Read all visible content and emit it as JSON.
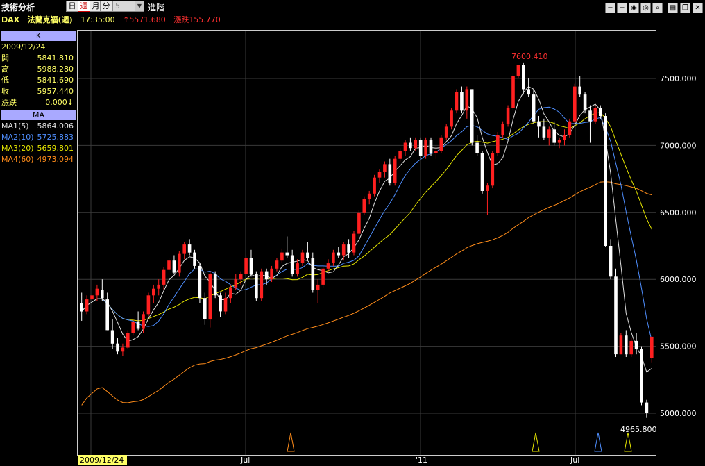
{
  "app": {
    "title": "技術分析"
  },
  "toolbar": {
    "periods": [
      "日",
      "週",
      "月",
      "分"
    ],
    "active_period": "週",
    "minute_value": "5",
    "advanced_label": "進階"
  },
  "info": {
    "symbol": "DAX",
    "name": "法蘭克福(週)",
    "time": "17:35:00",
    "last_arrow": "↑",
    "last": "5571.680",
    "change_label": "漲跌",
    "change": "155.770"
  },
  "panel": {
    "k_header": "K",
    "date": "2009/12/24",
    "ohlc": [
      {
        "label": "開",
        "value": "5841.810"
      },
      {
        "label": "高",
        "value": "5988.280"
      },
      {
        "label": "低",
        "value": "5841.690"
      },
      {
        "label": "收",
        "value": "5957.440"
      },
      {
        "label": "漲跌",
        "value": "0.000↓"
      }
    ],
    "ma_header": "MA",
    "ma": [
      {
        "label": "MA1(5)",
        "value": "5864.006",
        "color": "#e0e0e0"
      },
      {
        "label": "MA2(10)",
        "value": "5725.883",
        "color": "#4f8fff"
      },
      {
        "label": "MA3(20)",
        "value": "5659.801",
        "color": "#e6e600"
      },
      {
        "label": "MA4(60)",
        "value": "4973.094",
        "color": "#ff8c1a"
      }
    ]
  },
  "chart_data": {
    "type": "candlestick",
    "y_ticks": [
      "7500.000",
      "7000.000",
      "6500.000",
      "6000.000",
      "5500.000",
      "5000.000"
    ],
    "x_ticks": [
      "2009/12/24",
      "Jul",
      "'11",
      "Jul"
    ],
    "ylim": [
      4800,
      7800
    ],
    "max_label": "7600.410",
    "min_label": "4965.800",
    "colors": {
      "up": "#ff2020",
      "down": "#ffffff",
      "ma5": "#e0e0e0",
      "ma10": "#4f8fff",
      "ma20": "#e6e600",
      "ma60": "#ff8c1a"
    },
    "candles": [
      [
        5820,
        5900,
        5690,
        5760
      ],
      [
        5760,
        5880,
        5740,
        5850
      ],
      [
        5850,
        5900,
        5800,
        5880
      ],
      [
        5880,
        5960,
        5840,
        5930
      ],
      [
        5920,
        6000,
        5840,
        5860
      ],
      [
        5850,
        5900,
        5620,
        5620
      ],
      [
        5620,
        5700,
        5480,
        5520
      ],
      [
        5520,
        5560,
        5440,
        5460
      ],
      [
        5460,
        5520,
        5430,
        5490
      ],
      [
        5490,
        5620,
        5480,
        5600
      ],
      [
        5600,
        5700,
        5580,
        5680
      ],
      [
        5680,
        5760,
        5620,
        5630
      ],
      [
        5630,
        5760,
        5600,
        5740
      ],
      [
        5740,
        5900,
        5720,
        5880
      ],
      [
        5880,
        5960,
        5820,
        5930
      ],
      [
        5930,
        6000,
        5880,
        5960
      ],
      [
        5960,
        6090,
        5920,
        6070
      ],
      [
        6070,
        6160,
        6050,
        6140
      ],
      [
        6140,
        6180,
        6040,
        6050
      ],
      [
        6050,
        6210,
        6020,
        6190
      ],
      [
        6190,
        6280,
        6150,
        6260
      ],
      [
        6260,
        6300,
        6180,
        6200
      ],
      [
        6200,
        6220,
        6080,
        6100
      ],
      [
        6100,
        6120,
        5820,
        5860
      ],
      [
        5860,
        5900,
        5660,
        5700
      ],
      [
        5700,
        6060,
        5640,
        6040
      ],
      [
        6040,
        6060,
        5860,
        5880
      ],
      [
        5880,
        5900,
        5720,
        5760
      ],
      [
        5760,
        5900,
        5740,
        5860
      ],
      [
        5860,
        5960,
        5820,
        5940
      ],
      [
        5940,
        6040,
        5920,
        6000
      ],
      [
        6000,
        6060,
        5960,
        6040
      ],
      [
        6040,
        6180,
        6020,
        6160
      ],
      [
        6160,
        6220,
        6020,
        6040
      ],
      [
        6040,
        6060,
        5840,
        5860
      ],
      [
        5860,
        6080,
        5840,
        6060
      ],
      [
        6060,
        6080,
        5960,
        6000
      ],
      [
        6000,
        6100,
        5980,
        6080
      ],
      [
        6080,
        6160,
        6060,
        6140
      ],
      [
        6140,
        6230,
        6120,
        6200
      ],
      [
        6200,
        6320,
        6160,
        6180
      ],
      [
        6180,
        6220,
        6020,
        6040
      ],
      [
        6040,
        6150,
        6020,
        6120
      ],
      [
        6120,
        6220,
        6100,
        6200
      ],
      [
        6200,
        6280,
        6140,
        6160
      ],
      [
        6160,
        6200,
        5900,
        5920
      ],
      [
        5920,
        6000,
        5820,
        5960
      ],
      [
        5960,
        6100,
        5940,
        6080
      ],
      [
        6080,
        6150,
        6060,
        6120
      ],
      [
        6120,
        6220,
        6100,
        6200
      ],
      [
        6200,
        6240,
        6160,
        6180
      ],
      [
        6180,
        6280,
        6140,
        6260
      ],
      [
        6260,
        6300,
        6160,
        6200
      ],
      [
        6200,
        6360,
        6180,
        6340
      ],
      [
        6340,
        6520,
        6320,
        6500
      ],
      [
        6500,
        6620,
        6480,
        6600
      ],
      [
        6600,
        6660,
        6560,
        6640
      ],
      [
        6640,
        6780,
        6620,
        6760
      ],
      [
        6760,
        6820,
        6720,
        6800
      ],
      [
        6800,
        6880,
        6760,
        6860
      ],
      [
        6860,
        6900,
        6700,
        6720
      ],
      [
        6720,
        6920,
        6700,
        6900
      ],
      [
        6900,
        6980,
        6880,
        6960
      ],
      [
        6960,
        7040,
        6920,
        7020
      ],
      [
        7020,
        7060,
        6960,
        6980
      ],
      [
        6980,
        7060,
        6960,
        7040
      ],
      [
        7040,
        7060,
        6900,
        6920
      ],
      [
        6920,
        7060,
        6900,
        7040
      ],
      [
        7040,
        7060,
        6920,
        6940
      ],
      [
        6940,
        7000,
        6900,
        6960
      ],
      [
        6960,
        7080,
        6940,
        7060
      ],
      [
        7060,
        7160,
        7040,
        7140
      ],
      [
        7140,
        7280,
        7120,
        7260
      ],
      [
        7260,
        7420,
        7240,
        7400
      ],
      [
        7400,
        7440,
        7240,
        7260
      ],
      [
        7260,
        7440,
        7200,
        7420
      ],
      [
        7420,
        7420,
        7000,
        7020
      ],
      [
        7020,
        7080,
        6920,
        6940
      ],
      [
        6940,
        6960,
        6640,
        6660
      ],
      [
        6660,
        6720,
        6480,
        6700
      ],
      [
        6700,
        6960,
        6680,
        6940
      ],
      [
        6940,
        7100,
        6920,
        7080
      ],
      [
        7080,
        7180,
        7060,
        7160
      ],
      [
        7160,
        7300,
        7140,
        7280
      ],
      [
        7280,
        7540,
        7260,
        7520
      ],
      [
        7520,
        7600,
        7500,
        7600
      ],
      [
        7600,
        7620,
        7380,
        7420
      ],
      [
        7420,
        7500,
        7360,
        7380
      ],
      [
        7380,
        7420,
        7160,
        7180
      ],
      [
        7180,
        7220,
        7060,
        7140
      ],
      [
        7140,
        7200,
        7040,
        7060
      ],
      [
        7060,
        7140,
        7000,
        7120
      ],
      [
        7120,
        7180,
        7000,
        7020
      ],
      [
        7020,
        7060,
        6980,
        7040
      ],
      [
        7040,
        7120,
        7000,
        7080
      ],
      [
        7080,
        7200,
        7060,
        7180
      ],
      [
        7180,
        7460,
        7160,
        7440
      ],
      [
        7440,
        7520,
        7360,
        7380
      ],
      [
        7380,
        7400,
        7240,
        7260
      ],
      [
        7260,
        7300,
        7020,
        7180
      ],
      [
        7180,
        7300,
        7160,
        7280
      ],
      [
        7280,
        7300,
        7200,
        7220
      ],
      [
        7220,
        7240,
        6240,
        6250
      ],
      [
        6250,
        6300,
        6000,
        6020
      ],
      [
        6020,
        6080,
        5420,
        5440
      ],
      [
        5440,
        5600,
        5440,
        5580
      ],
      [
        5580,
        5620,
        5420,
        5440
      ],
      [
        5440,
        5560,
        5420,
        5540
      ],
      [
        5540,
        5600,
        5440,
        5480
      ],
      [
        5480,
        5500,
        5060,
        5080
      ],
      [
        5080,
        5100,
        4965,
        5000
      ],
      [
        5410,
        5560,
        5380,
        5571
      ]
    ]
  }
}
